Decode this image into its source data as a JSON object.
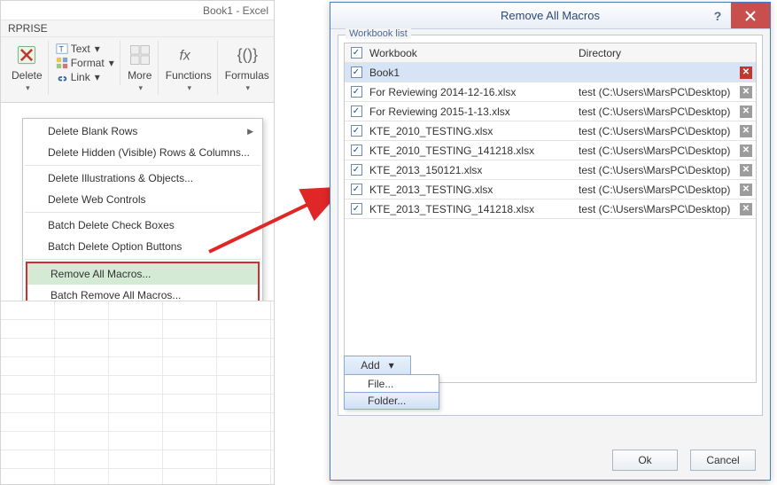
{
  "excel": {
    "title": "Book1 - Excel",
    "tab_label": "RPRISE",
    "ribbon": {
      "delete": {
        "label": "Delete"
      },
      "text": "Text",
      "format": "Format",
      "link": "Link",
      "more": "More",
      "functions": "Functions",
      "formulas": "Formulas"
    },
    "menu": [
      {
        "label": "Delete Blank Rows",
        "submenu": true
      },
      {
        "label": "Delete Hidden (Visible) Rows & Columns..."
      },
      {
        "sep": true
      },
      {
        "label": "Delete Illustrations & Objects..."
      },
      {
        "label": "Delete Web Controls"
      },
      {
        "sep": true
      },
      {
        "label": "Batch Delete Check Boxes"
      },
      {
        "label": "Batch Delete Option Buttons"
      },
      {
        "sep": true
      },
      {
        "box": true,
        "items": [
          {
            "label": "Remove All Macros...",
            "selected": true
          },
          {
            "label": "Batch Remove All Macros..."
          }
        ]
      }
    ]
  },
  "dialog": {
    "title": "Remove All Macros",
    "group_label": "Workbook list",
    "columns": {
      "workbook": "Workbook",
      "directory": "Directory"
    },
    "rows": [
      {
        "wb": "Book1",
        "dir": "",
        "selected": true,
        "xred": true
      },
      {
        "wb": "For Reviewing 2014-12-16.xlsx",
        "dir": "test (C:\\Users\\MarsPC\\Desktop)"
      },
      {
        "wb": "For Reviewing 2015-1-13.xlsx",
        "dir": "test (C:\\Users\\MarsPC\\Desktop)"
      },
      {
        "wb": "KTE_2010_TESTING.xlsx",
        "dir": "test (C:\\Users\\MarsPC\\Desktop)"
      },
      {
        "wb": "KTE_2010_TESTING_141218.xlsx",
        "dir": "test (C:\\Users\\MarsPC\\Desktop)"
      },
      {
        "wb": "KTE_2013_150121.xlsx",
        "dir": "test (C:\\Users\\MarsPC\\Desktop)"
      },
      {
        "wb": "KTE_2013_TESTING.xlsx",
        "dir": "test (C:\\Users\\MarsPC\\Desktop)"
      },
      {
        "wb": "KTE_2013_TESTING_141218.xlsx",
        "dir": "test (C:\\Users\\MarsPC\\Desktop)"
      }
    ],
    "add_btn": "Add",
    "add_menu": {
      "file": "File...",
      "folder": "Folder..."
    },
    "ok": "Ok",
    "cancel": "Cancel"
  }
}
